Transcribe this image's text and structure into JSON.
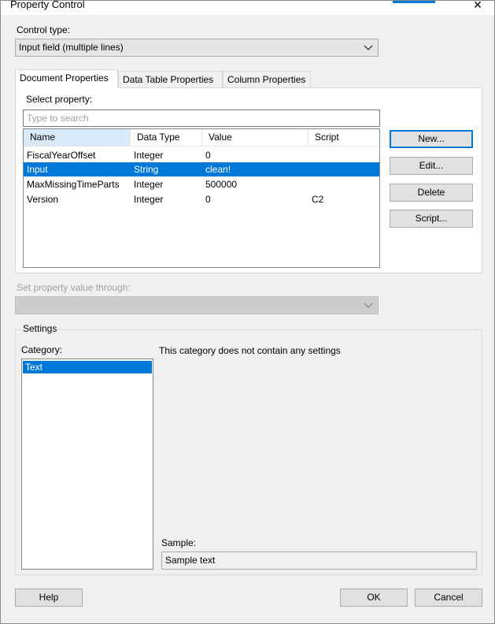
{
  "window": {
    "title": "Property Control",
    "close_icon": "close-icon",
    "accent_color": "#0078d7"
  },
  "control_type": {
    "label": "Control type:",
    "value": "Input field (multiple lines)"
  },
  "tabs": [
    {
      "label": "Document Properties",
      "active": true
    },
    {
      "label": "Data Table Properties",
      "active": false
    },
    {
      "label": "Column Properties",
      "active": false
    }
  ],
  "select_property": {
    "label": "Select property:",
    "search_placeholder": "Type to search"
  },
  "table": {
    "columns": [
      "Name",
      "Data Type",
      "Value",
      "Script"
    ],
    "rows": [
      {
        "name": "FiscalYearOffset",
        "type": "Integer",
        "value": "0",
        "script": "",
        "selected": false
      },
      {
        "name": "Input",
        "type": "String",
        "value": "clean!",
        "script": "",
        "selected": true
      },
      {
        "name": "MaxMissingTimeParts",
        "type": "Integer",
        "value": "500000",
        "script": "",
        "selected": false
      },
      {
        "name": "Version",
        "type": "Integer",
        "value": "0",
        "script": "C2",
        "selected": false
      }
    ]
  },
  "side_buttons": {
    "new": "New...",
    "edit": "Edit...",
    "delete": "Delete",
    "script": "Script..."
  },
  "set_property": {
    "label": "Set property value through:",
    "value": ""
  },
  "settings": {
    "group_label": "Settings",
    "category_label": "Category:",
    "categories": [
      {
        "label": "Text",
        "selected": true
      }
    ],
    "message": "This category does not contain any settings",
    "sample_label": "Sample:",
    "sample_value": "Sample text"
  },
  "footer": {
    "help": "Help",
    "ok": "OK",
    "cancel": "Cancel"
  }
}
